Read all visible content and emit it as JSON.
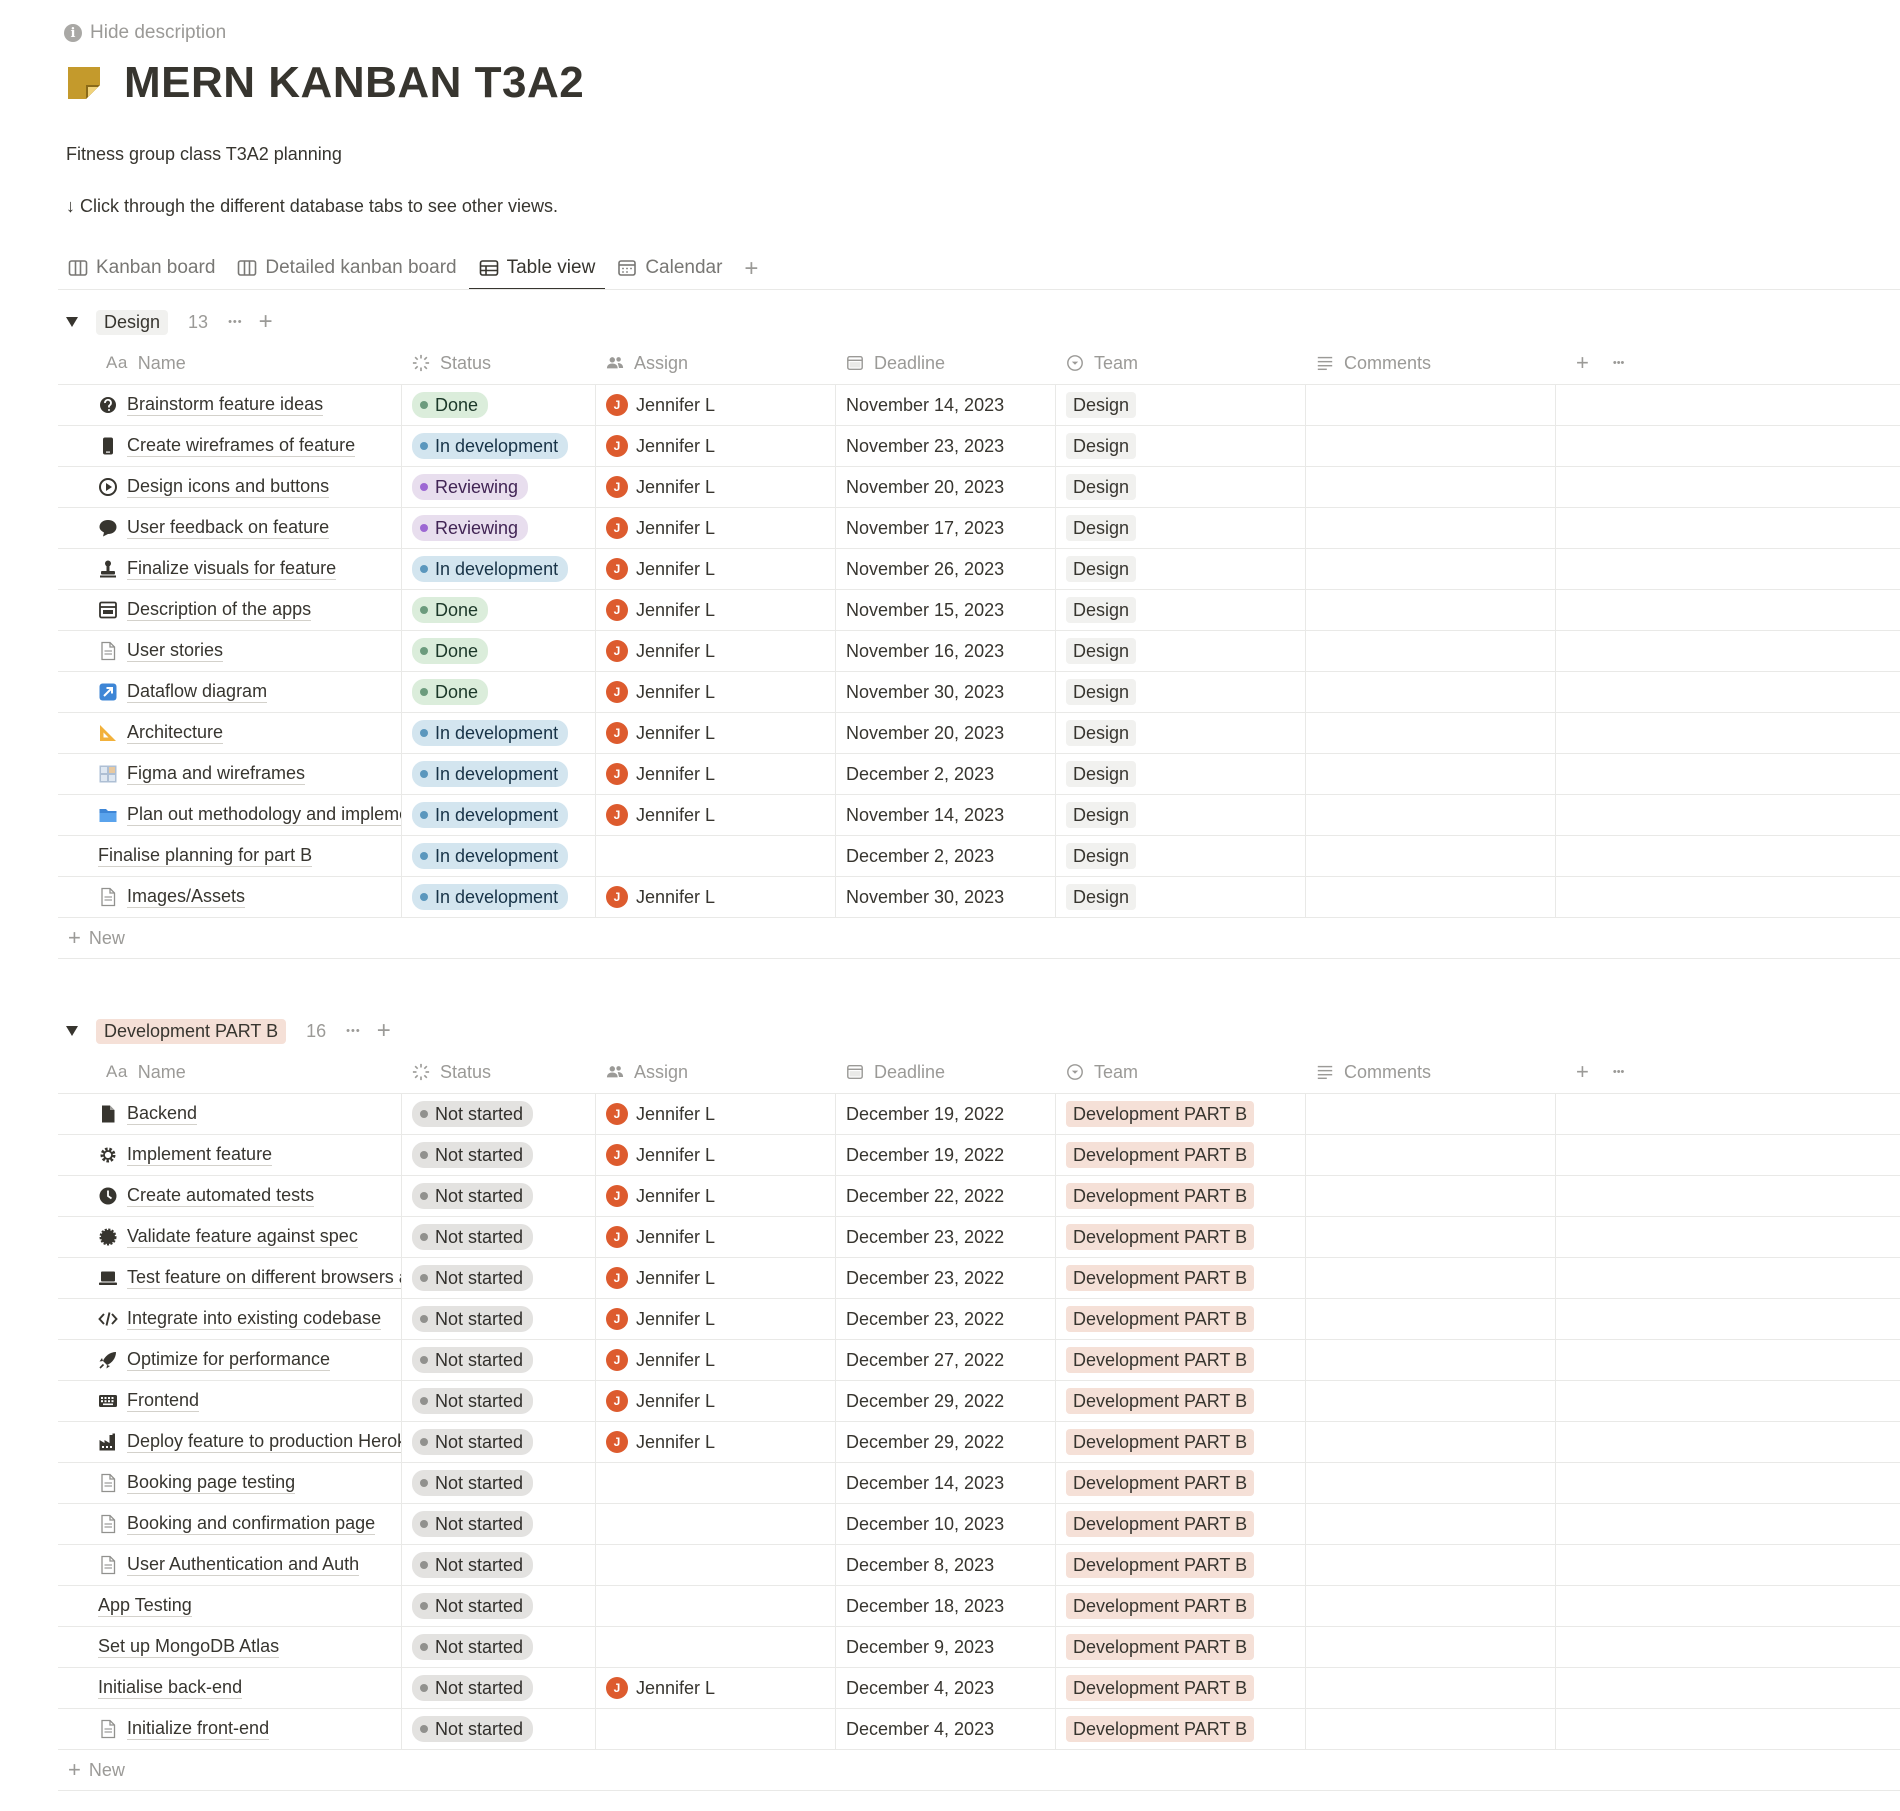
{
  "header": {
    "hide_description": "Hide description",
    "title": "MERN KANBAN T3A2",
    "description_1": "Fitness group class T3A2 planning",
    "description_2": "↓ Click through the different database tabs to see other views."
  },
  "tabs": [
    {
      "label": "Kanban board",
      "icon": "board-icon",
      "active": false
    },
    {
      "label": "Detailed kanban board",
      "icon": "board-icon",
      "active": false
    },
    {
      "label": "Table view",
      "icon": "table-icon",
      "active": true
    },
    {
      "label": "Calendar",
      "icon": "calendar-icon",
      "active": false
    }
  ],
  "columns": {
    "name": "Name",
    "status": "Status",
    "assign": "Assign",
    "deadline": "Deadline",
    "team": "Team",
    "comments": "Comments",
    "aa": "Aa"
  },
  "new_label": "New",
  "status_styles": {
    "Done": {
      "bg": "#dbeddb",
      "dot": "#6c9b7d",
      "fg": "#1c3829"
    },
    "In development": {
      "bg": "#d3e5ef",
      "dot": "#5b97bd",
      "fg": "#183347"
    },
    "Reviewing": {
      "bg": "#e8deee",
      "dot": "#9d68d3",
      "fg": "#412454"
    },
    "Not started": {
      "bg": "#e3e2e0",
      "dot": "#91918e",
      "fg": "#32302c"
    }
  },
  "groups": [
    {
      "label": "Design",
      "count": "13",
      "chip_bg": "#f1f1ef",
      "team_bg": "#f1f1ef",
      "rows": [
        {
          "name": "Brainstorm feature ideas",
          "icon": "brain-icon",
          "status": "Done",
          "assign": "Jennifer L",
          "deadline": "November 14, 2023",
          "team": "Design"
        },
        {
          "name": "Create wireframes of feature",
          "icon": "phone-icon",
          "status": "In development",
          "assign": "Jennifer L",
          "deadline": "November 23, 2023",
          "team": "Design"
        },
        {
          "name": "Design icons and buttons",
          "icon": "play-icon",
          "status": "Reviewing",
          "assign": "Jennifer L",
          "deadline": "November 20, 2023",
          "team": "Design"
        },
        {
          "name": "User feedback on feature",
          "icon": "speech-bubble-icon",
          "status": "Reviewing",
          "assign": "Jennifer L",
          "deadline": "November 17, 2023",
          "team": "Design"
        },
        {
          "name": "Finalize visuals for feature",
          "icon": "stamp-icon",
          "status": "In development",
          "assign": "Jennifer L",
          "deadline": "November 26, 2023",
          "team": "Design"
        },
        {
          "name": "Description of the apps",
          "icon": "window-icon",
          "status": "Done",
          "assign": "Jennifer L",
          "deadline": "November 15, 2023",
          "team": "Design"
        },
        {
          "name": "User stories",
          "icon": "document-icon",
          "status": "Done",
          "assign": "Jennifer L",
          "deadline": "November 16, 2023",
          "team": "Design"
        },
        {
          "name": "Dataflow diagram",
          "icon": "arrow-box-icon",
          "status": "Done",
          "assign": "Jennifer L",
          "deadline": "November 30, 2023",
          "team": "Design"
        },
        {
          "name": "Architecture",
          "icon": "triangle-ruler-icon",
          "status": "In development",
          "assign": "Jennifer L",
          "deadline": "November 20, 2023",
          "team": "Design"
        },
        {
          "name": "Figma and wireframes",
          "icon": "grid-icon",
          "status": "In development",
          "assign": "Jennifer L",
          "deadline": "December 2, 2023",
          "team": "Design"
        },
        {
          "name": "Plan out methodology and implementation",
          "icon": "folder-icon",
          "status": "In development",
          "assign": "Jennifer L",
          "deadline": "November 14, 2023",
          "team": "Design"
        },
        {
          "name": "Finalise planning for part B",
          "icon": "",
          "status": "In development",
          "assign": "",
          "deadline": "December 2, 2023",
          "team": "Design"
        },
        {
          "name": "Images/Assets",
          "icon": "document-icon",
          "status": "In development",
          "assign": "Jennifer L",
          "deadline": "November 30, 2023",
          "team": "Design"
        }
      ]
    },
    {
      "label": "Development PART B",
      "count": "16",
      "chip_bg": "#f5e0d7",
      "team_bg": "#f5e0d7",
      "rows": [
        {
          "name": "Backend",
          "icon": "file-icon",
          "status": "Not started",
          "assign": "Jennifer L",
          "deadline": "December 19, 2022",
          "team": "Development PART B"
        },
        {
          "name": "Implement feature",
          "icon": "gear-icon",
          "status": "Not started",
          "assign": "Jennifer L",
          "deadline": "December 19, 2022",
          "team": "Development PART B"
        },
        {
          "name": "Create automated tests",
          "icon": "clock-icon",
          "status": "Not started",
          "assign": "Jennifer L",
          "deadline": "December 22, 2022",
          "team": "Development PART B"
        },
        {
          "name": "Validate feature against spec",
          "icon": "badge-icon",
          "status": "Not started",
          "assign": "Jennifer L",
          "deadline": "December 23, 2022",
          "team": "Development PART B"
        },
        {
          "name": "Test feature on different browsers and devices",
          "icon": "laptop-icon",
          "status": "Not started",
          "assign": "Jennifer L",
          "deadline": "December 23, 2022",
          "team": "Development PART B"
        },
        {
          "name": "Integrate into existing codebase",
          "icon": "code-icon",
          "status": "Not started",
          "assign": "Jennifer L",
          "deadline": "December 23, 2022",
          "team": "Development PART B"
        },
        {
          "name": "Optimize for performance",
          "icon": "rocket-icon",
          "status": "Not started",
          "assign": "Jennifer L",
          "deadline": "December 27, 2022",
          "team": "Development PART B"
        },
        {
          "name": "Frontend",
          "icon": "keyboard-icon",
          "status": "Not started",
          "assign": "Jennifer L",
          "deadline": "December 29, 2022",
          "team": "Development PART B"
        },
        {
          "name": "Deploy feature to production Heroku",
          "icon": "factory-icon",
          "status": "Not started",
          "assign": "Jennifer L",
          "deadline": "December 29, 2022",
          "team": "Development PART B"
        },
        {
          "name": "Booking page testing",
          "icon": "document-icon",
          "status": "Not started",
          "assign": "",
          "deadline": "December 14, 2023",
          "team": "Development PART B"
        },
        {
          "name": "Booking and confirmation page",
          "icon": "document-icon",
          "status": "Not started",
          "assign": "",
          "deadline": "December 10, 2023",
          "team": "Development PART B"
        },
        {
          "name": "User Authentication and Auth",
          "icon": "document-icon",
          "status": "Not started",
          "assign": "",
          "deadline": "December 8, 2023",
          "team": "Development PART B"
        },
        {
          "name": "App Testing",
          "icon": "",
          "status": "Not started",
          "assign": "",
          "deadline": "December 18, 2023",
          "team": "Development PART B"
        },
        {
          "name": "Set up MongoDB Atlas",
          "icon": "",
          "status": "Not started",
          "assign": "",
          "deadline": "December 9, 2023",
          "team": "Development PART B"
        },
        {
          "name": "Initialise back-end",
          "icon": "",
          "status": "Not started",
          "assign": "Jennifer L",
          "deadline": "December 4, 2023",
          "team": "Development PART B"
        },
        {
          "name": "Initialize front-end",
          "icon": "document-icon",
          "status": "Not started",
          "assign": "",
          "deadline": "December 4, 2023",
          "team": "Development PART B"
        }
      ]
    }
  ]
}
